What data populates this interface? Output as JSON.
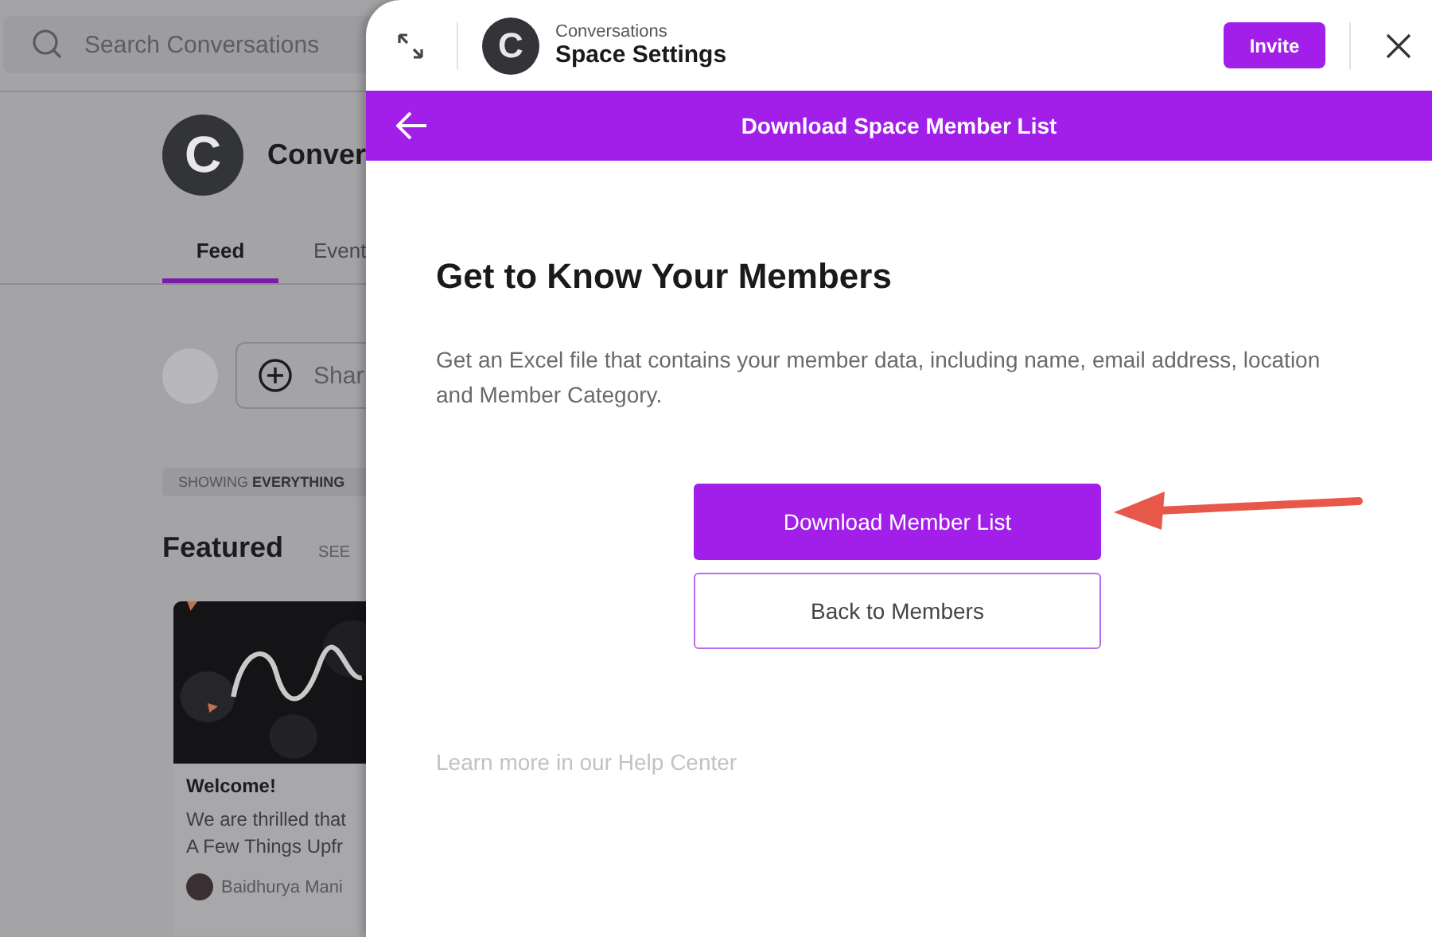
{
  "background": {
    "search": {
      "placeholder": "Search Conversations"
    },
    "space": {
      "avatar_letter": "C",
      "name": "Conver"
    },
    "tabs": [
      {
        "label": "Feed",
        "selected": true
      },
      {
        "label": "Event",
        "selected": false
      }
    ],
    "composer": {
      "placeholder": "Shar"
    },
    "filter_chip": "SHOWING **EVERYTHING**",
    "featured": {
      "title": "Featured",
      "see_link": "SEE",
      "card": {
        "title": "Welcome!",
        "lines": [
          "We are thrilled that",
          "A Few Things Upfr"
        ],
        "author": "Baidhurya Mani"
      }
    }
  },
  "panel": {
    "header": {
      "avatar_letter": "C",
      "subtitle": "Conversations",
      "title": "Space Settings",
      "invite": "Invite"
    },
    "bar": {
      "title": "Download Space Member List"
    },
    "heading": "Get to Know Your Members",
    "description": "Get an Excel file that contains your member data, including name, email address, location and Member Category.",
    "buttons": [
      {
        "label": "Download Member List",
        "kind": "primary"
      },
      {
        "label": "Back to Members",
        "kind": "secondary"
      }
    ],
    "help_link": "Learn more in our Help Center"
  }
}
